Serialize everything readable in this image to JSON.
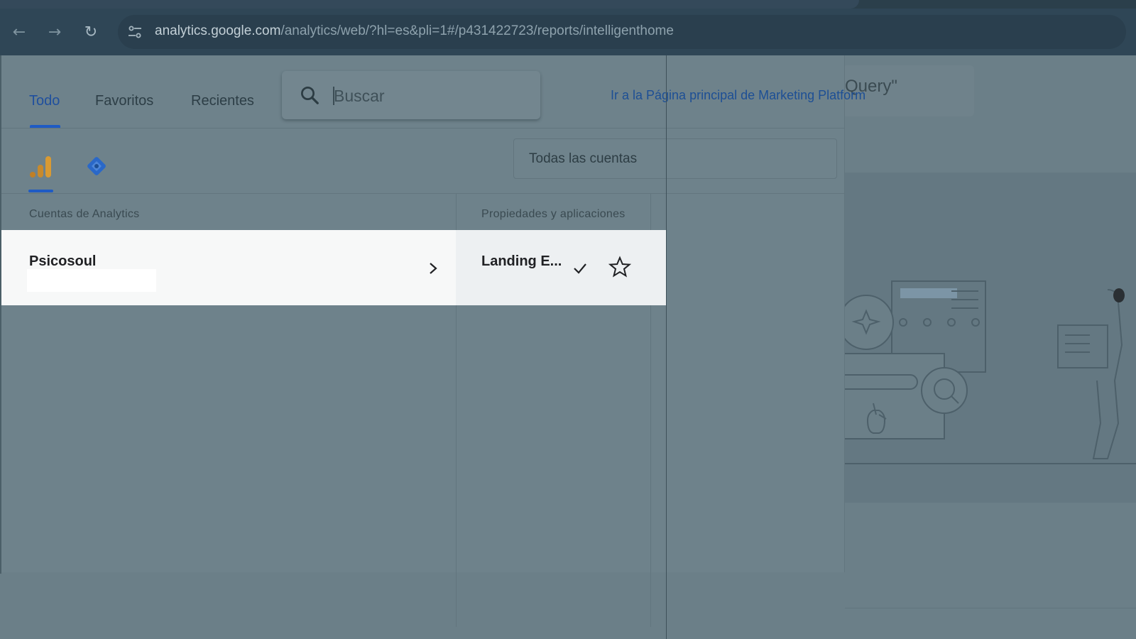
{
  "browser": {
    "url_domain": "analytics.google.com",
    "url_path": "/analytics/web/?hl=es&pli=1#/p431422723/reports/intelligenthome"
  },
  "picker": {
    "tabs": [
      {
        "label": "Todo",
        "active": true
      },
      {
        "label": "Favoritos",
        "active": false
      },
      {
        "label": "Recientes",
        "active": false
      }
    ],
    "search_placeholder": "Buscar",
    "marketing_link": "Ir a la Página principal de Marketing Platform",
    "accounts_filter": "Todas las cuentas",
    "col_accounts": "Cuentas de Analytics",
    "col_properties": "Propiedades y aplicaciones",
    "account_name": "Psicosoul",
    "property_name": "Landing E...",
    "products": [
      {
        "icon": "analytics-icon",
        "color": "#e8a33a",
        "selected": true
      },
      {
        "icon": "tag-manager-icon",
        "color": "#2c6fd6",
        "selected": false
      }
    ]
  },
  "background": {
    "query_text": "Query\""
  },
  "colors": {
    "accent": "#1f5bc4",
    "link": "#1d4f95",
    "overlay": "#6b7f88",
    "row_highlight": "#f7f8f8"
  }
}
